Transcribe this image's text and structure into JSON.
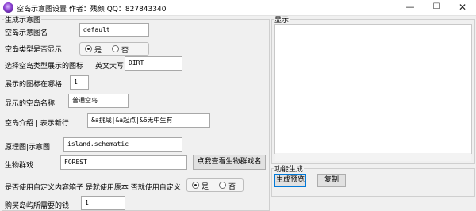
{
  "window": {
    "title": "空岛示意图设置    作者：残颜   QQ：827843340",
    "min_glyph": "—",
    "max_glyph": "☐",
    "close_glyph": "✕"
  },
  "left_panel": {
    "group_title": "生成示意图",
    "map_name_label": "空岛示意图名",
    "map_name_value": "default",
    "type_display_label": "空岛类型是否显示",
    "type_display_yes": "是",
    "type_display_no": "否",
    "type_display_selected": "是",
    "icon_label": "选择空岛类型展示的图标",
    "icon_sublabel": "英文大写",
    "icon_value": "DIRT",
    "icon_slot_label": "展示的图标在哪格",
    "icon_slot_value": "1",
    "island_name_label": "显示的空岛名称",
    "island_name_value": "普通空岛",
    "intro_label": "空岛介绍 | 表示新行",
    "intro_value": "&a挑战|&a起点|&6无中生有",
    "schematic_label": "原理图|示意图",
    "schematic_value": "island.schematic",
    "biome_label": "生物群戏",
    "biome_value": "FOREST",
    "biome_button": "点我查看生物群戏名",
    "custom_box_label": "是否使用自定义内容箱子 是就使用原本 否就使用自定义",
    "custom_yes": "是",
    "custom_no": "否",
    "custom_selected": "是",
    "price_label": "购买岛屿所需要的钱",
    "price_value": "1"
  },
  "right_panel": {
    "display_title": "显示",
    "display_content": "",
    "function_title": "功能生成",
    "generate_preview_button": "生成预览",
    "copy_button": "复制"
  }
}
